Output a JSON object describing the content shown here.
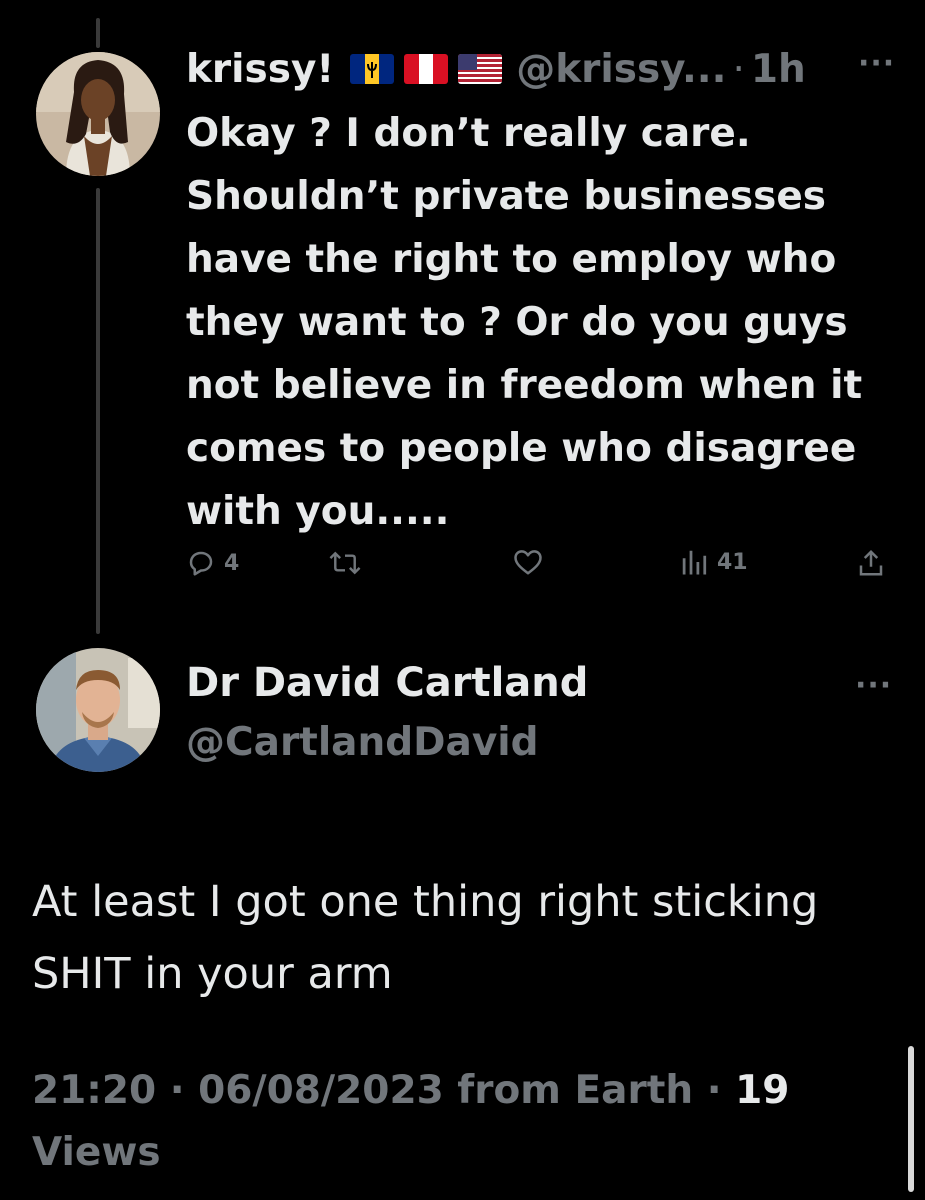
{
  "tweet1": {
    "display_name": "krissy!",
    "flags": [
      "barbados-flag-icon",
      "peru-flag-icon",
      "usa-flag-icon"
    ],
    "handle": "@krissy...",
    "separator": "·",
    "time": "1h",
    "more_label": "···",
    "lines": [
      "Okay ? I don’t really care.",
      "Shouldn’t private businesses",
      "have the right to employ who",
      "they want to ? Or do you guys",
      "not believe in freedom when it",
      "comes to people who disagree",
      "with you....."
    ],
    "actions": {
      "reply_count": "4",
      "retweet_count": "",
      "like_count": "",
      "views_count": "41"
    }
  },
  "tweet2": {
    "display_name": "Dr David Cartland",
    "handle": "@CartlandDavid",
    "more_label": "···",
    "lines": [
      "At least I got one thing right sticking",
      "SHIT in your arm"
    ],
    "meta": {
      "time": "21:20",
      "date": "06/08/2023",
      "source": "from Earth",
      "views_count": "19",
      "views_label": "Views",
      "separator": "·"
    }
  },
  "colors": {
    "background": "#000000",
    "primary_text": "#e7e9ea",
    "secondary_text": "#71767b",
    "thread_line": "#3a3a3a"
  }
}
